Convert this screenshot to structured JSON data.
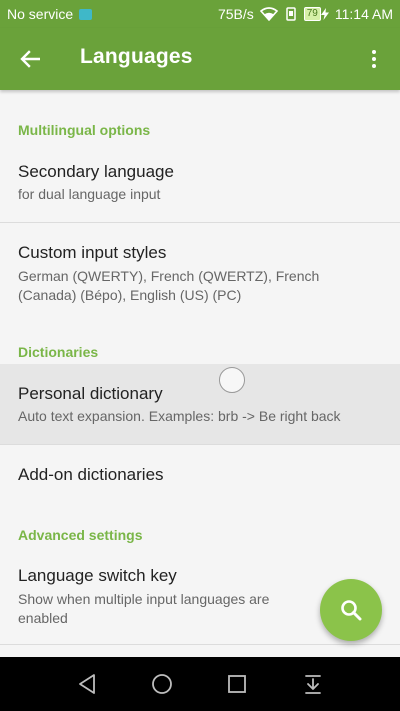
{
  "status_bar": {
    "carrier": "No service",
    "speed": "75B/s",
    "battery": "79",
    "time": "11:14 AM"
  },
  "app_bar": {
    "title": "Languages"
  },
  "sections": {
    "multilingual": "Multilingual options",
    "dictionaries": "Dictionaries",
    "advanced": "Advanced settings"
  },
  "prefs": {
    "secondary_language": {
      "title": "Secondary language",
      "summary": "for dual language input"
    },
    "custom_input_styles": {
      "title": "Custom input styles",
      "summary": "German (QWERTY), French (QWERTZ), French (Canada) (Bépo), English (US) (PC)"
    },
    "personal_dictionary": {
      "title": "Personal dictionary",
      "summary": "Auto text expansion. Examples: brb -> Be right back"
    },
    "addon_dictionaries": {
      "title": "Add-on dictionaries"
    },
    "language_switch_key": {
      "title": "Language switch key",
      "summary": "Show when multiple input languages are enabled"
    }
  },
  "colors": {
    "app_bar": "#6aa23a",
    "section_header": "#7ab648",
    "fab": "#8bc34a"
  },
  "icons": {
    "back": "arrow-left-icon",
    "more": "more-vertical-icon",
    "fab": "search-icon",
    "nav": [
      "back-triangle-icon",
      "home-circle-icon",
      "recents-square-icon",
      "notification-pulldown-icon"
    ]
  }
}
